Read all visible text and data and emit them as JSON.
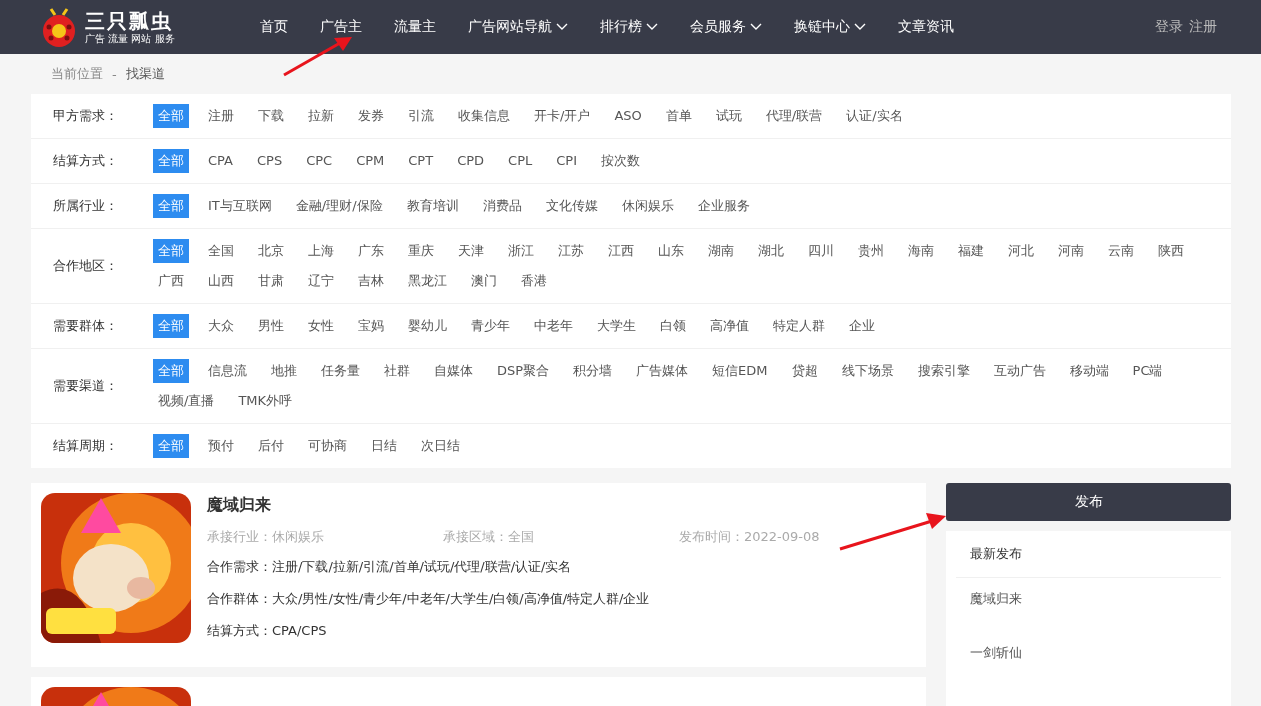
{
  "header": {
    "logo": {
      "name": "三只瓢虫",
      "tagline": "广告 流量 网站 服务"
    },
    "nav": [
      {
        "label": "首页",
        "dropdown": false
      },
      {
        "label": "广告主",
        "dropdown": false
      },
      {
        "label": "流量主",
        "dropdown": false
      },
      {
        "label": "广告网站导航",
        "dropdown": true
      },
      {
        "label": "排行榜",
        "dropdown": true
      },
      {
        "label": "会员服务",
        "dropdown": true
      },
      {
        "label": "换链中心",
        "dropdown": true
      },
      {
        "label": "文章资讯",
        "dropdown": false
      }
    ],
    "account": [
      "登录",
      "注册"
    ]
  },
  "breadcrumb": {
    "items": [
      "当前位置",
      "找渠道"
    ],
    "separator": "-"
  },
  "filters": [
    {
      "label": "甲方需求：",
      "options": [
        {
          "text": "全部",
          "selected": true
        },
        {
          "text": "注册",
          "selected": false
        },
        {
          "text": "下载",
          "selected": false
        },
        {
          "text": "拉新",
          "selected": false
        },
        {
          "text": "发券",
          "selected": false
        },
        {
          "text": "引流",
          "selected": false
        },
        {
          "text": "收集信息",
          "selected": false
        },
        {
          "text": "开卡/开户",
          "selected": false
        },
        {
          "text": "ASO",
          "selected": false
        },
        {
          "text": "首单",
          "selected": false
        },
        {
          "text": "试玩",
          "selected": false
        },
        {
          "text": "代理/联营",
          "selected": false
        },
        {
          "text": "认证/实名",
          "selected": false
        }
      ]
    },
    {
      "label": "结算方式：",
      "options": [
        {
          "text": "全部",
          "selected": true
        },
        {
          "text": "CPA",
          "selected": false
        },
        {
          "text": "CPS",
          "selected": false
        },
        {
          "text": "CPC",
          "selected": false
        },
        {
          "text": "CPM",
          "selected": false
        },
        {
          "text": "CPT",
          "selected": false
        },
        {
          "text": "CPD",
          "selected": false
        },
        {
          "text": "CPL",
          "selected": false
        },
        {
          "text": "CPI",
          "selected": false
        },
        {
          "text": "按次数",
          "selected": false
        }
      ]
    },
    {
      "label": "所属行业：",
      "options": [
        {
          "text": "全部",
          "selected": true
        },
        {
          "text": "IT与互联网",
          "selected": false
        },
        {
          "text": "金融/理财/保险",
          "selected": false
        },
        {
          "text": "教育培训",
          "selected": false
        },
        {
          "text": "消费品",
          "selected": false
        },
        {
          "text": "文化传媒",
          "selected": false
        },
        {
          "text": "休闲娱乐",
          "selected": false
        },
        {
          "text": "企业服务",
          "selected": false
        }
      ]
    },
    {
      "label": "合作地区：",
      "options": [
        {
          "text": "全部",
          "selected": true
        },
        {
          "text": "全国",
          "selected": false
        },
        {
          "text": "北京",
          "selected": false
        },
        {
          "text": "上海",
          "selected": false
        },
        {
          "text": "广东",
          "selected": false
        },
        {
          "text": "重庆",
          "selected": false
        },
        {
          "text": "天津",
          "selected": false
        },
        {
          "text": "浙江",
          "selected": false
        },
        {
          "text": "江苏",
          "selected": false
        },
        {
          "text": "江西",
          "selected": false
        },
        {
          "text": "山东",
          "selected": false
        },
        {
          "text": "湖南",
          "selected": false
        },
        {
          "text": "湖北",
          "selected": false
        },
        {
          "text": "四川",
          "selected": false
        },
        {
          "text": "贵州",
          "selected": false
        },
        {
          "text": "海南",
          "selected": false
        },
        {
          "text": "福建",
          "selected": false
        },
        {
          "text": "河北",
          "selected": false
        },
        {
          "text": "河南",
          "selected": false
        },
        {
          "text": "云南",
          "selected": false
        },
        {
          "text": "陕西",
          "selected": false
        },
        {
          "text": "广西",
          "selected": false
        },
        {
          "text": "山西",
          "selected": false
        },
        {
          "text": "甘肃",
          "selected": false
        },
        {
          "text": "辽宁",
          "selected": false
        },
        {
          "text": "吉林",
          "selected": false
        },
        {
          "text": "黑龙江",
          "selected": false
        },
        {
          "text": "澳门",
          "selected": false
        },
        {
          "text": "香港",
          "selected": false
        }
      ]
    },
    {
      "label": "需要群体：",
      "options": [
        {
          "text": "全部",
          "selected": true
        },
        {
          "text": "大众",
          "selected": false
        },
        {
          "text": "男性",
          "selected": false
        },
        {
          "text": "女性",
          "selected": false
        },
        {
          "text": "宝妈",
          "selected": false
        },
        {
          "text": "婴幼儿",
          "selected": false
        },
        {
          "text": "青少年",
          "selected": false
        },
        {
          "text": "中老年",
          "selected": false
        },
        {
          "text": "大学生",
          "selected": false
        },
        {
          "text": "白领",
          "selected": false
        },
        {
          "text": "高净值",
          "selected": false
        },
        {
          "text": "特定人群",
          "selected": false
        },
        {
          "text": "企业",
          "selected": false
        }
      ]
    },
    {
      "label": "需要渠道：",
      "options": [
        {
          "text": "全部",
          "selected": true
        },
        {
          "text": "信息流",
          "selected": false
        },
        {
          "text": "地推",
          "selected": false
        },
        {
          "text": "任务量",
          "selected": false
        },
        {
          "text": "社群",
          "selected": false
        },
        {
          "text": "自媒体",
          "selected": false
        },
        {
          "text": "DSP聚合",
          "selected": false
        },
        {
          "text": "积分墙",
          "selected": false
        },
        {
          "text": "广告媒体",
          "selected": false
        },
        {
          "text": "短信EDM",
          "selected": false
        },
        {
          "text": "贷超",
          "selected": false
        },
        {
          "text": "线下场景",
          "selected": false
        },
        {
          "text": "搜索引擎",
          "selected": false
        },
        {
          "text": "互动广告",
          "selected": false
        },
        {
          "text": "移动端",
          "selected": false
        },
        {
          "text": "PC端",
          "selected": false
        },
        {
          "text": "视频/直播",
          "selected": false
        },
        {
          "text": "TMK外呼",
          "selected": false
        }
      ]
    },
    {
      "label": "结算周期：",
      "options": [
        {
          "text": "全部",
          "selected": true
        },
        {
          "text": "预付",
          "selected": false
        },
        {
          "text": "后付",
          "selected": false
        },
        {
          "text": "可协商",
          "selected": false
        },
        {
          "text": "日结",
          "selected": false
        },
        {
          "text": "次日结",
          "selected": false
        }
      ]
    }
  ],
  "listings": [
    {
      "thumbnail": {
        "kind": "picture"
      },
      "title": "魔域归来",
      "industry": "承接行业：休闲娱乐",
      "region": "承接区域：全国",
      "date": "发布时间：2022-09-08",
      "demand": "合作需求：注册/下载/拉新/引流/首单/试玩/代理/联营/认证/实名",
      "audience": "合作群体：大众/男性/女性/青少年/中老年/大学生/白领/高净值/特定人群/企业",
      "settlement": "结算方式：CPA/CPS"
    },
    {
      "thumbnail": {
        "kind": "picture"
      }
    }
  ],
  "sidebar": {
    "publish_button": "发布",
    "latest": {
      "title": "最新发布",
      "items": [
        "魔域归来",
        "一剑斩仙"
      ]
    }
  },
  "annotations": [
    {
      "kind": "arrow"
    },
    {
      "kind": "arrow"
    }
  ]
}
